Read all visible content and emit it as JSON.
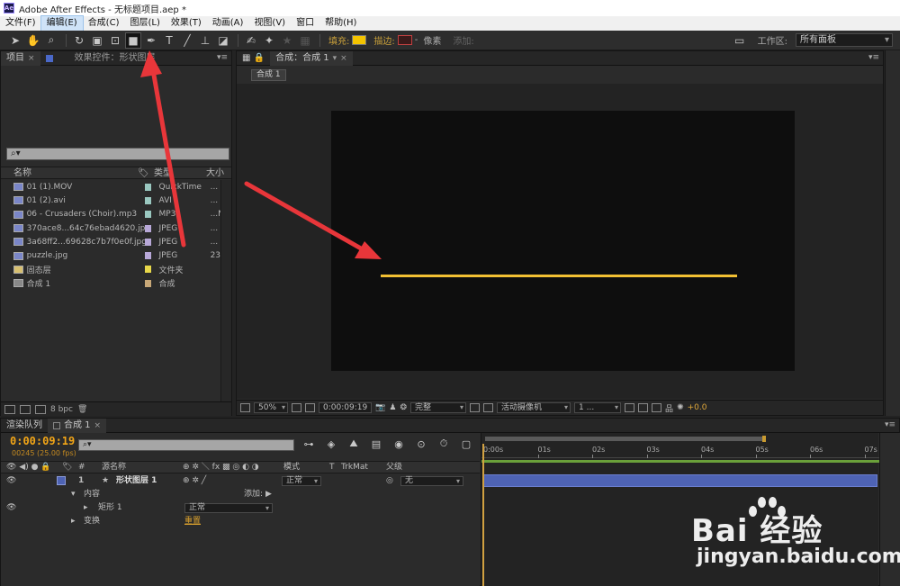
{
  "window": {
    "app_badge": "Ae",
    "title": "Adobe After Effects - 无标题项目.aep *"
  },
  "menu": [
    "文件(F)",
    "编辑(E)",
    "合成(C)",
    "图层(L)",
    "效果(T)",
    "动画(A)",
    "视图(V)",
    "窗口",
    "帮助(H)"
  ],
  "toolbar": {
    "fill_label": "填充:",
    "stroke_label": "描边:",
    "stroke_unit": "像素",
    "add_label": "添加:",
    "workspace_label": "工作区:",
    "workspace_value": "所有面板",
    "fill_color": "#f4c400"
  },
  "project": {
    "tabs": [
      "项目",
      "效果控件：形状图层"
    ],
    "search_placeholder": "⌕▾",
    "headers": {
      "name": "名称",
      "type": "类型",
      "size": "大小"
    },
    "items": [
      {
        "name": "01 (1).MOV",
        "type": "QuickTime",
        "size": "...",
        "label": "#9ac8c0",
        "icon": "video-file-icon"
      },
      {
        "name": "01 (2).avi",
        "type": "AVI",
        "size": "...",
        "label": "#9ac8c0",
        "icon": "video-file-icon"
      },
      {
        "name": "06 - Crusaders (Choir).mp3",
        "type": "MP3",
        "size": "...N",
        "label": "#9ac8c0",
        "icon": "audio-file-icon"
      },
      {
        "name": "370ace8...64c76ebad4620.jpg",
        "type": "JPEG",
        "size": "...",
        "label": "#b8a8d8",
        "icon": "image-file-icon"
      },
      {
        "name": "3a68ff2...69628c7b7f0e0f.jpg",
        "type": "JPEG",
        "size": "...",
        "label": "#b8a8d8",
        "icon": "image-file-icon"
      },
      {
        "name": "puzzle.jpg",
        "type": "JPEG",
        "size": "23",
        "label": "#b8a8d8",
        "icon": "image-file-icon"
      },
      {
        "name": "固态层",
        "type": "文件夹",
        "size": "",
        "label": "#e8d84a",
        "icon": "folder-icon"
      },
      {
        "name": "合成 1",
        "type": "合成",
        "size": "",
        "label": "#c8a878",
        "icon": "composition-icon"
      }
    ],
    "bpc": "8 bpc"
  },
  "viewer": {
    "tab": "合成：合成 1",
    "subtab": "合成 1",
    "zoom": "50%",
    "timecode": "0:00:09:19",
    "resolution": "完整",
    "camera": "活动摄像机",
    "views": "1 ...",
    "exposure": "+0.0",
    "line_color": "#f2c033"
  },
  "timeline": {
    "tabs": [
      "渲染队列",
      "合成 1"
    ],
    "timecode": "0:00:09:19",
    "frames": "00245 (25.00 fps)",
    "search_placeholder": "⌕▾",
    "headers": {
      "num": "#",
      "source": "源名称",
      "switches": "⊕ ✲ ＼ fx ▩ ◎ ◐ ◑",
      "mode": "模式",
      "t": "T",
      "trkmat": "TrkMat",
      "parent": "父级"
    },
    "layer": {
      "num": "1",
      "star": "★",
      "name": "形状图层 1",
      "mode": "正常",
      "parent": "无"
    },
    "contents": {
      "label": "内容",
      "add": "添加:"
    },
    "rect": {
      "label": "矩形 1",
      "mode": "正常"
    },
    "transform": {
      "label": "变换",
      "reset": "重置"
    },
    "ruler": [
      "0:00s",
      "01s",
      "02s",
      "03s",
      "04s",
      "05s",
      "06s",
      "07s"
    ]
  },
  "watermark": {
    "brand": "Bai  经验",
    "url": "jingyan.baidu.com"
  }
}
